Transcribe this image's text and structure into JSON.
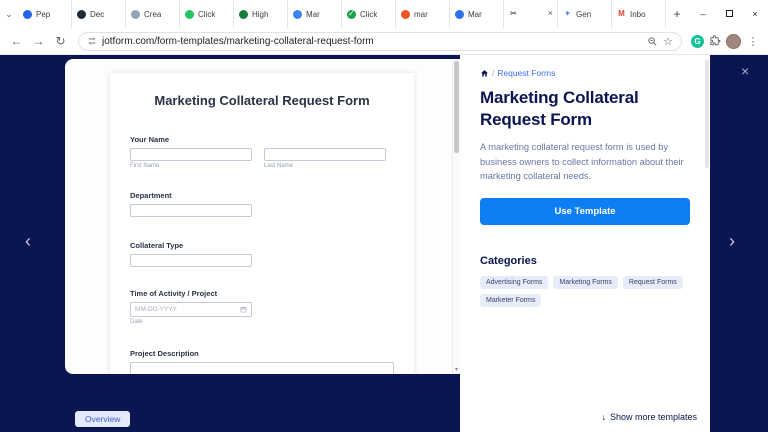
{
  "accent": {
    "navy": "#0a1551",
    "blue": "#0d7ff2",
    "link_blue": "#3e6ef6",
    "grammarly_green": "#15c39a"
  },
  "browser": {
    "tab_search_icon": "⌄",
    "tabs": [
      {
        "label": "Pep",
        "glyph": "",
        "bg": "#2563eb",
        "fg": "#ffffff"
      },
      {
        "label": "Dec",
        "glyph": "",
        "bg": "#1e293b",
        "fg": "#ffffff"
      },
      {
        "label": "Crea",
        "glyph": "",
        "bg": "#94a3b8",
        "fg": "#ffffff"
      },
      {
        "label": "Click",
        "glyph": "",
        "bg": "#22c55e",
        "fg": "#ffffff"
      },
      {
        "label": "High",
        "glyph": "",
        "bg": "#15803d",
        "fg": "#ffffff"
      },
      {
        "label": "Mar",
        "glyph": "",
        "bg": "#3b82f6",
        "fg": "#ffffff"
      },
      {
        "label": "Click",
        "glyph": "✓",
        "bg": "#16a34a",
        "fg": "#ffffff"
      },
      {
        "label": "mar",
        "glyph": "",
        "bg": "#f05423",
        "fg": "#ffffff"
      },
      {
        "label": "Mar",
        "glyph": "",
        "bg": "#2f6fed",
        "fg": "#ffffff"
      },
      {
        "label": "",
        "glyph": "✂",
        "bg": "transparent",
        "fg": "#111827",
        "close": "×"
      },
      {
        "label": "Gen",
        "glyph": "✦",
        "bg": "transparent",
        "fg": "#4e7cf6"
      },
      {
        "label": "Inbo",
        "glyph": "M",
        "bg": "transparent",
        "fg": "#ea4335"
      }
    ],
    "new_tab_label": "+",
    "window_controls": {
      "minimize": "–",
      "close": "×"
    },
    "nav": {
      "back": "←",
      "forward": "→",
      "refresh": "↻",
      "star": "☆",
      "menu": "⋮",
      "grammarly": "G"
    },
    "url": "jotform.com/form-templates/marketing-collateral-request-form"
  },
  "preview": {
    "form": {
      "title": "Marketing Collateral Request Form",
      "name": {
        "label": "Your Name",
        "first_sublabel": "First Name",
        "last_sublabel": "Last Name"
      },
      "department": {
        "label": "Department"
      },
      "collateral": {
        "label": "Collateral Type"
      },
      "activity": {
        "label": "Time of Activity / Project",
        "placeholder": "MM-DD-YYYY",
        "sublabel": "Date"
      },
      "description": {
        "label": "Project Description"
      }
    },
    "scrollbar_down": "▾"
  },
  "panel": {
    "breadcrumb": {
      "separator": "/",
      "link": "Request Forms"
    },
    "title": "Marketing Collateral Request Form",
    "description": "A marketing collateral request form is used by business owners to collect information about their marketing collateral needs.",
    "use_template": "Use Template",
    "categories_title": "Categories",
    "categories": [
      "Advertising Forms",
      "Marketing Forms",
      "Request Forms",
      "Marketer Forms"
    ],
    "show_more_arrow": "↓",
    "show_more": "Show more templates"
  },
  "overlay": {
    "close": "×",
    "prev": "‹",
    "next": "›",
    "overview": "Overview"
  }
}
